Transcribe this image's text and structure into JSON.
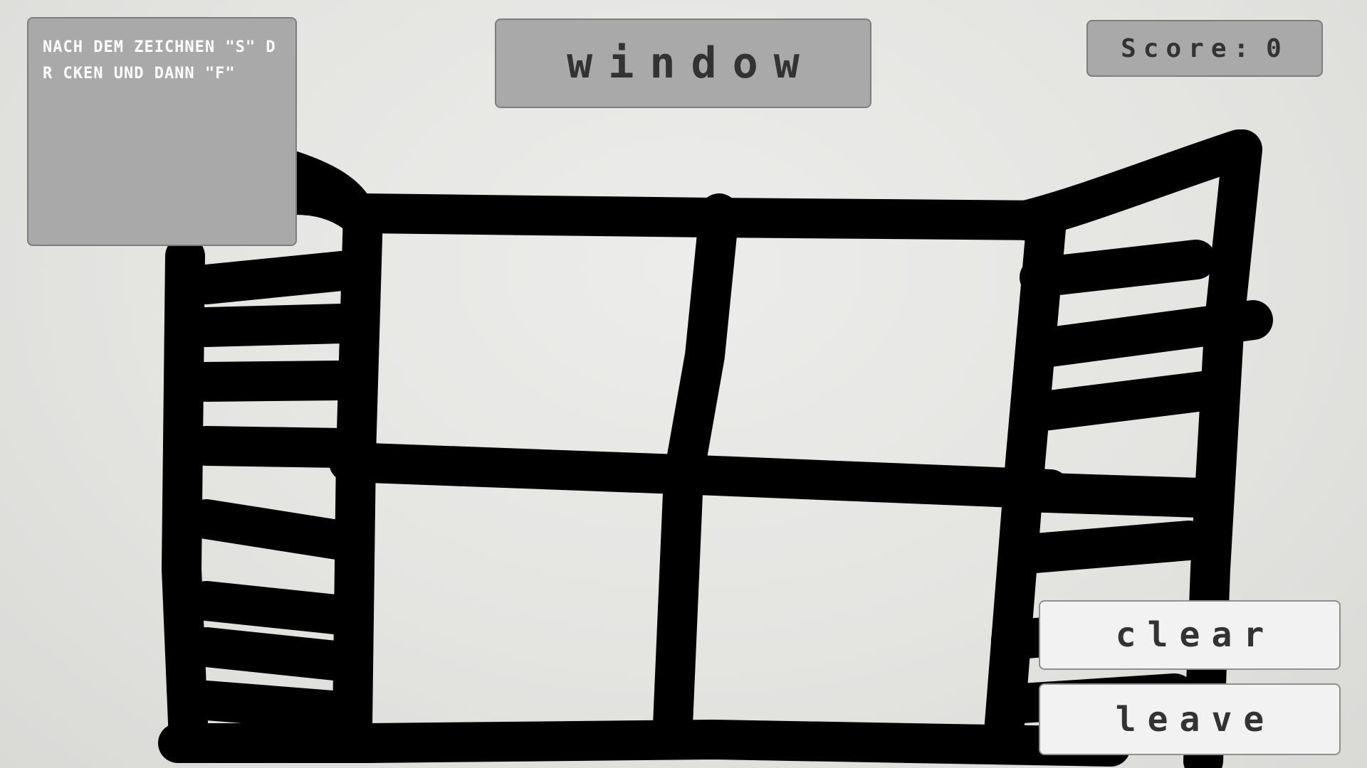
{
  "hint": {
    "text": "NACH DEM ZEICHNEN \"S\" DR CKEN UND DANN \"F\""
  },
  "word": {
    "text": "window"
  },
  "score": {
    "label": "Score:",
    "value": "0"
  },
  "buttons": {
    "clear_label": "clear",
    "leave_label": "leave"
  },
  "drawing": {
    "subject": "window",
    "stroke_color": "#000000"
  },
  "colors": {
    "panel_gray": "#a9a9a9",
    "text_dark": "#333333",
    "button_bg": "#f2f2f2"
  }
}
